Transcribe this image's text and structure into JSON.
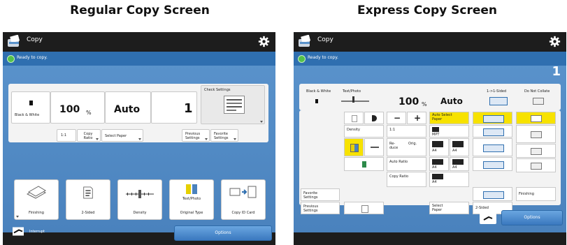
{
  "headings": {
    "regular": "Regular Copy Screen",
    "express": "Express Copy Screen"
  },
  "regular": {
    "app_title": "Copy",
    "status": "Ready to copy.",
    "color_mode": "Black & White",
    "ratio_value": "100",
    "ratio_unit": "%",
    "paper_value": "Auto",
    "copies": "1",
    "check_settings": "Check Settings",
    "ratio_1to1": "1:1",
    "copy_ratio": "Copy Ratio",
    "select_paper": "Select Paper",
    "previous_settings": "Previous Settings",
    "favorite_settings": "Favorite Settings",
    "functions": [
      "Finishing",
      "2-Sided",
      "Density",
      "Original Type",
      "Copy ID Card"
    ],
    "original_type_inner": "Text/Photo",
    "interrupt": "Interrupt",
    "options": "Options"
  },
  "express": {
    "app_title": "Copy",
    "status": "Ready to copy.",
    "copies": "1",
    "black_white": "Black & White",
    "text_photo": "Text/Photo",
    "ratio_value": "100",
    "ratio_unit": "%",
    "paper_value": "Auto",
    "one_sided": "1->1-Sided",
    "do_not_collate": "Do Not Collate",
    "auto_select_paper": "Auto Select Paper",
    "density": "Density",
    "ratio_1to1": "1:1",
    "reduce_orig": "Re-duce",
    "orig": "Orig.",
    "auto_ratio": "Auto Ratio",
    "copy_ratio": "Copy Ratio",
    "mp_tray": "MPT",
    "paper_a4": "A4",
    "select_paper": "Select Paper",
    "two_sided": "2-Sided",
    "finishing": "Finishing",
    "favorite_settings": "Favorite Settings",
    "previous_settings": "Previous Settings",
    "options": "Options"
  }
}
